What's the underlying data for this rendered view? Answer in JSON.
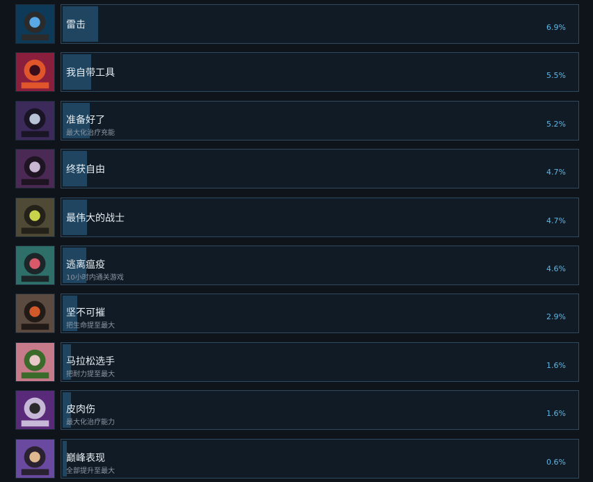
{
  "achievements": [
    {
      "title": "雷击",
      "description": "",
      "percent_label": "6.9%",
      "percent": 6.9,
      "icon": "lightning-orb-icon",
      "colors": [
        "#0e3a5a",
        "#5aa9e6",
        "#2b2b2b"
      ]
    },
    {
      "title": "我自带工具",
      "description": "",
      "percent_label": "5.5%",
      "percent": 5.5,
      "icon": "demon-lantern-icon",
      "colors": [
        "#8a1f3d",
        "#3a0d1a",
        "#e0562a"
      ]
    },
    {
      "title": "准备好了",
      "description": "最大化治疗充能",
      "percent_label": "5.2%",
      "percent": 5.2,
      "icon": "crystal-spike-icon",
      "colors": [
        "#3b2a5a",
        "#b8c4d6",
        "#1a1525"
      ]
    },
    {
      "title": "终获自由",
      "description": "",
      "percent_label": "4.7%",
      "percent": 4.7,
      "icon": "chained-prisoner-icon",
      "colors": [
        "#4a2a55",
        "#c9b6d2",
        "#1f1422"
      ]
    },
    {
      "title": "最伟大的战士",
      "description": "",
      "percent_label": "4.7%",
      "percent": 4.7,
      "icon": "stone-warrior-icon",
      "colors": [
        "#4e4a35",
        "#c8d24a",
        "#23211a"
      ]
    },
    {
      "title": "逃离瘟疫",
      "description": "10小时内通关游戏",
      "percent_label": "4.6%",
      "percent": 4.6,
      "icon": "plague-face-icon",
      "colors": [
        "#2f6f6a",
        "#d85a6a",
        "#1c2528"
      ]
    },
    {
      "title": "坚不可摧",
      "description": "把生命提至最大",
      "percent_label": "2.9%",
      "percent": 2.9,
      "icon": "stone-face-icon",
      "colors": [
        "#5a4a40",
        "#d25a2a",
        "#221a16"
      ]
    },
    {
      "title": "马拉松选手",
      "description": "把耐力提至最大",
      "percent_label": "1.6%",
      "percent": 1.6,
      "icon": "mouse-runner-icon",
      "colors": [
        "#c77a8a",
        "#e8c8c8",
        "#3a6b2a"
      ]
    },
    {
      "title": "皮肉伤",
      "description": "最大化治疗能力",
      "percent_label": "1.6%",
      "percent": 1.6,
      "icon": "hooded-figure-icon",
      "colors": [
        "#5a2a7a",
        "#2a2a2a",
        "#c8b8d8"
      ]
    },
    {
      "title": "巅峰表现",
      "description": "全部提升至最大",
      "percent_label": "0.6%",
      "percent": 0.6,
      "icon": "hero-portrait-icon",
      "colors": [
        "#6a4aa0",
        "#e0b890",
        "#2a2230"
      ]
    }
  ]
}
